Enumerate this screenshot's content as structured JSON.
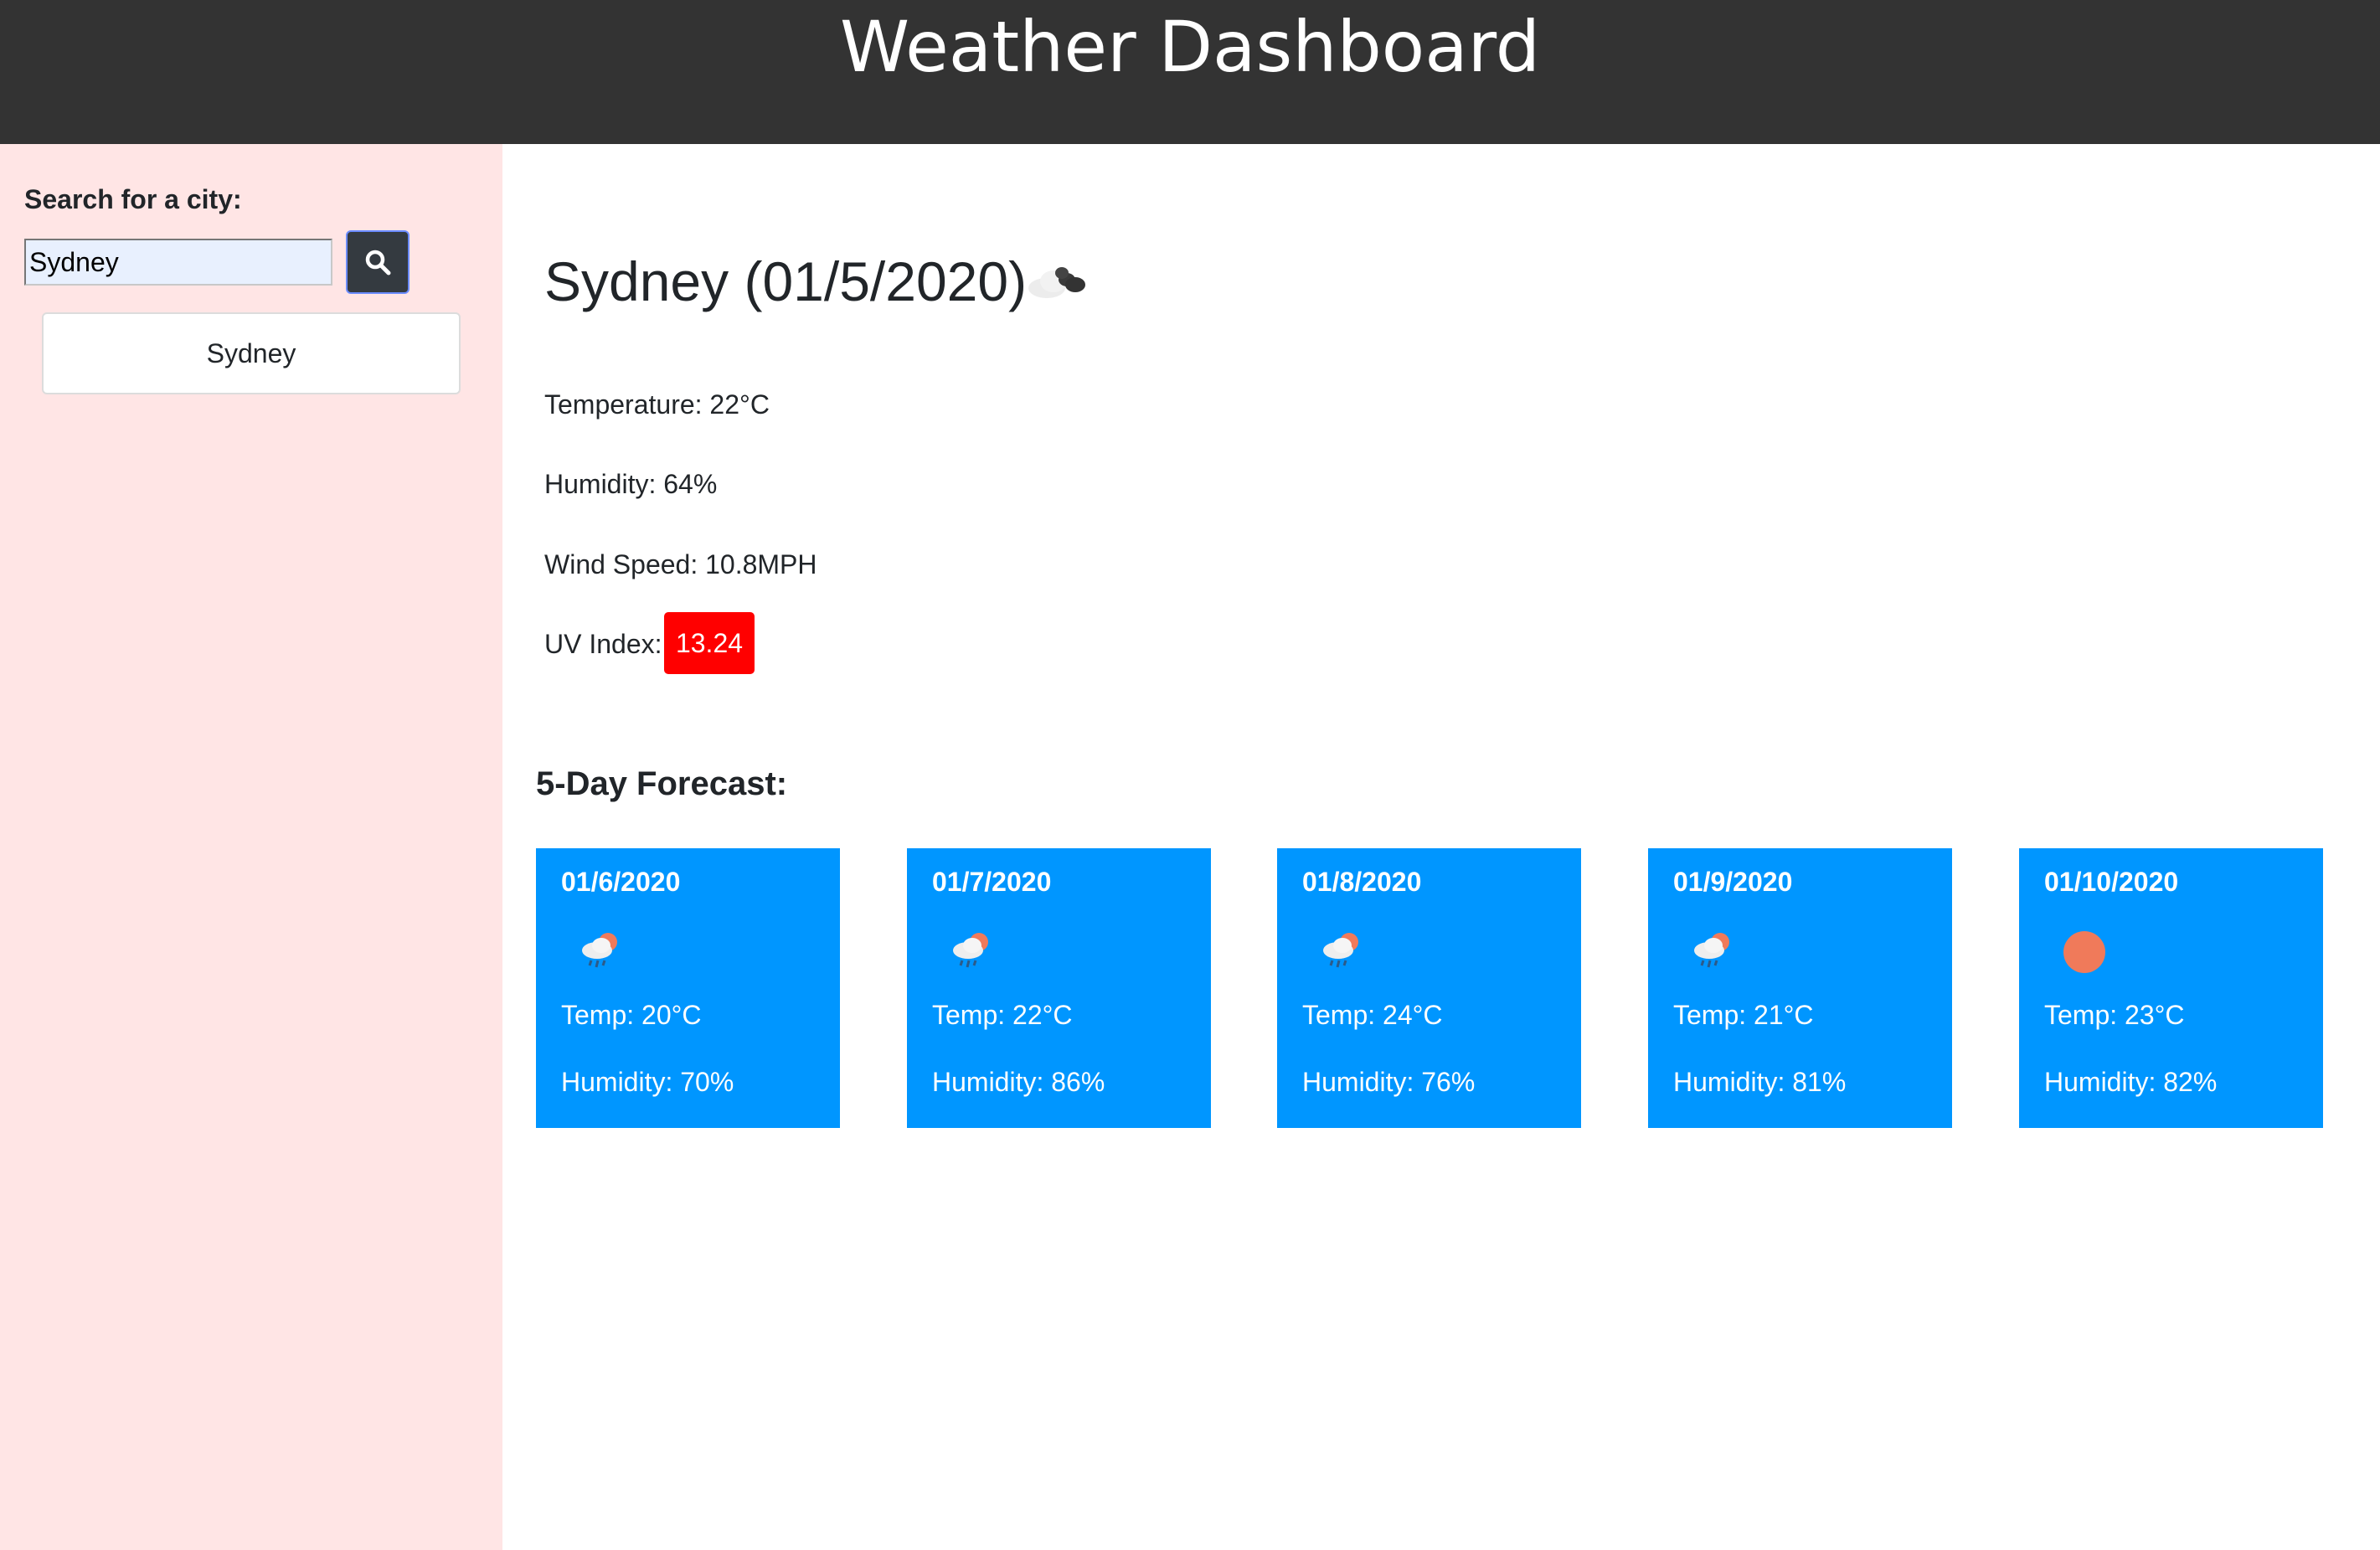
{
  "header": {
    "title": "Weather Dashboard"
  },
  "sidebar": {
    "search_label": "Search for a city:",
    "search_value": "Sydney",
    "history": [
      "Sydney"
    ]
  },
  "current": {
    "title": "Sydney (01/5/2020)",
    "icon": "broken-clouds-icon",
    "temperature": "Temperature: 22°C",
    "humidity": "Humidity: 64%",
    "wind": "Wind Speed: 10.8MPH",
    "uv_label": "UV Index:",
    "uv_value": "13.24"
  },
  "forecast": {
    "heading": "5-Day Forecast:",
    "days": [
      {
        "date": "01/6/2020",
        "icon": "rain-sun-icon",
        "temp": "Temp: 20°C",
        "humidity": "Humidity: 70%"
      },
      {
        "date": "01/7/2020",
        "icon": "rain-sun-icon",
        "temp": "Temp: 22°C",
        "humidity": "Humidity: 86%"
      },
      {
        "date": "01/8/2020",
        "icon": "rain-sun-icon",
        "temp": "Temp: 24°C",
        "humidity": "Humidity: 76%"
      },
      {
        "date": "01/9/2020",
        "icon": "rain-sun-icon",
        "temp": "Temp: 21°C",
        "humidity": "Humidity: 81%"
      },
      {
        "date": "01/10/2020",
        "icon": "sun-icon",
        "temp": "Temp: 23°C",
        "humidity": "Humidity: 82%"
      }
    ]
  },
  "colors": {
    "header_bg": "#333333",
    "sidebar_bg": "#ffe5e5",
    "card_bg": "#0096ff",
    "uv_bg": "#ff0000",
    "sun": "#f07a5a"
  }
}
